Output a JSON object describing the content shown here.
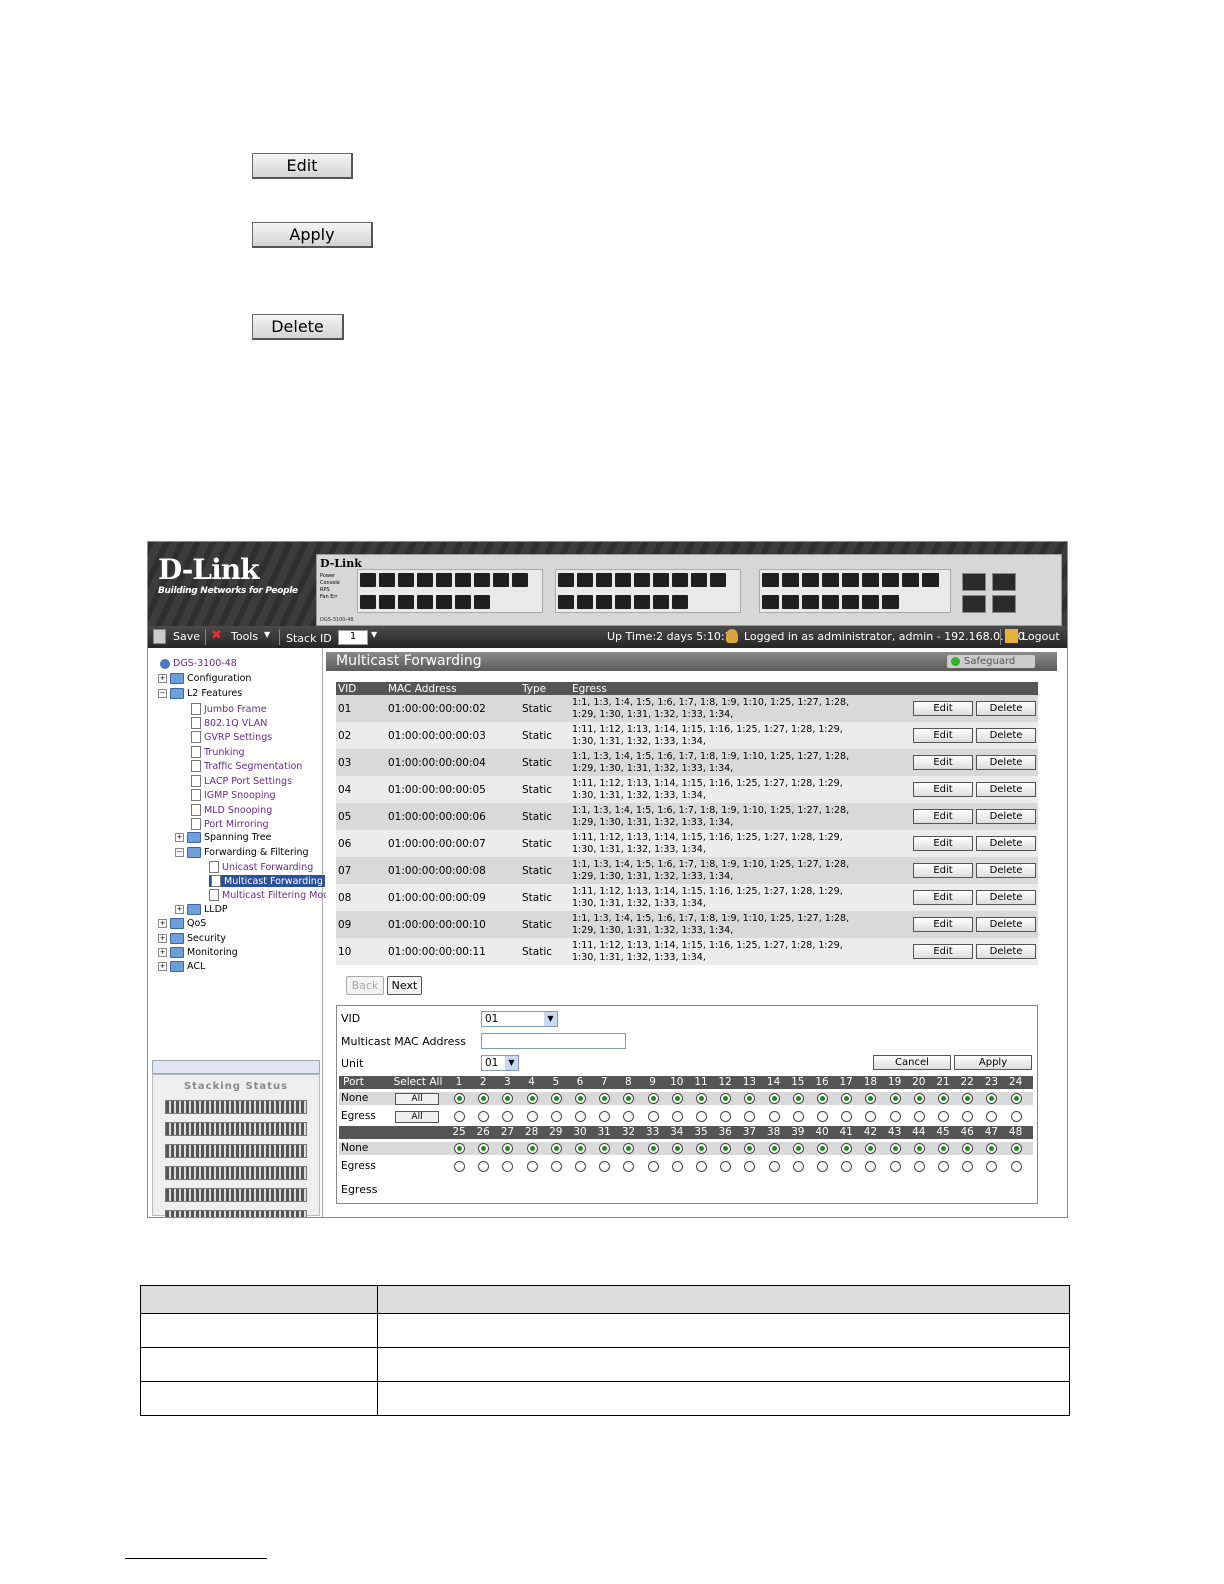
{
  "doc_buttons": {
    "edit": "Edit",
    "apply": "Apply",
    "delete": "Delete"
  },
  "banner": {
    "brand": "D-Link",
    "tagline": "Building Networks for People",
    "switch_brand": "D-Link",
    "switch_model": "DGS-3100-48",
    "leds": [
      "Power",
      "Console",
      "RPS",
      "Fan Err"
    ]
  },
  "toolbar": {
    "save": "Save",
    "tools": "Tools",
    "stack_id_label": "Stack ID",
    "stack_id_value": "1",
    "uptime": "Up Time:2 days 5:10:13",
    "logged_in": "Logged in as administrator, admin - 192.168.0.100",
    "logout": "Logout"
  },
  "sidebar": {
    "root": "DGS-3100-48",
    "configuration": "Configuration",
    "l2": "L2 Features",
    "items": [
      "Jumbo Frame",
      "802.1Q VLAN",
      "GVRP Settings",
      "Trunking",
      "Traffic Segmentation",
      "LACP Port Settings",
      "IGMP Snooping",
      "MLD Snooping",
      "Port Mirroring"
    ],
    "spanning": "Spanning Tree",
    "fwd": "Forwarding & Filtering",
    "fwd_items": [
      "Unicast Forwarding",
      "Multicast Forwarding",
      "Multicast Filtering Mode"
    ],
    "lldp": "LLDP",
    "qos": "QoS",
    "security": "Security",
    "monitoring": "Monitoring",
    "acl": "ACL",
    "stacking": "Stacking Status"
  },
  "page": {
    "title": "Multicast Forwarding",
    "safeguard": "Safeguard"
  },
  "table": {
    "headers": [
      "VID",
      "MAC Address",
      "Type",
      "Egress"
    ],
    "edit": "Edit",
    "delete": "Delete",
    "rows": [
      {
        "vid": "01",
        "mac": "01:00:00:00:00:02",
        "type": "Static",
        "egress1": "1:1, 1:3, 1:4, 1:5, 1:6, 1:7, 1:8, 1:9, 1:10, 1:25, 1:27, 1:28,",
        "egress2": "1:29, 1:30, 1:31, 1:32, 1:33, 1:34,"
      },
      {
        "vid": "02",
        "mac": "01:00:00:00:00:03",
        "type": "Static",
        "egress1": "1:11, 1:12, 1:13, 1:14, 1:15, 1:16, 1:25, 1:27, 1:28, 1:29,",
        "egress2": "1:30, 1:31, 1:32, 1:33, 1:34,"
      },
      {
        "vid": "03",
        "mac": "01:00:00:00:00:04",
        "type": "Static",
        "egress1": "1:1, 1:3, 1:4, 1:5, 1:6, 1:7, 1:8, 1:9, 1:10, 1:25, 1:27, 1:28,",
        "egress2": "1:29, 1:30, 1:31, 1:32, 1:33, 1:34,"
      },
      {
        "vid": "04",
        "mac": "01:00:00:00:00:05",
        "type": "Static",
        "egress1": "1:11, 1:12, 1:13, 1:14, 1:15, 1:16, 1:25, 1:27, 1:28, 1:29,",
        "egress2": "1:30, 1:31, 1:32, 1:33, 1:34,"
      },
      {
        "vid": "05",
        "mac": "01:00:00:00:00:06",
        "type": "Static",
        "egress1": "1:1, 1:3, 1:4, 1:5, 1:6, 1:7, 1:8, 1:9, 1:10, 1:25, 1:27, 1:28,",
        "egress2": "1:29, 1:30, 1:31, 1:32, 1:33, 1:34,"
      },
      {
        "vid": "06",
        "mac": "01:00:00:00:00:07",
        "type": "Static",
        "egress1": "1:11, 1:12, 1:13, 1:14, 1:15, 1:16, 1:25, 1:27, 1:28, 1:29,",
        "egress2": "1:30, 1:31, 1:32, 1:33, 1:34,"
      },
      {
        "vid": "07",
        "mac": "01:00:00:00:00:08",
        "type": "Static",
        "egress1": "1:1, 1:3, 1:4, 1:5, 1:6, 1:7, 1:8, 1:9, 1:10, 1:25, 1:27, 1:28,",
        "egress2": "1:29, 1:30, 1:31, 1:32, 1:33, 1:34,"
      },
      {
        "vid": "08",
        "mac": "01:00:00:00:00:09",
        "type": "Static",
        "egress1": "1:11, 1:12, 1:13, 1:14, 1:15, 1:16, 1:25, 1:27, 1:28, 1:29,",
        "egress2": "1:30, 1:31, 1:32, 1:33, 1:34,"
      },
      {
        "vid": "09",
        "mac": "01:00:00:00:00:10",
        "type": "Static",
        "egress1": "1:1, 1:3, 1:4, 1:5, 1:6, 1:7, 1:8, 1:9, 1:10, 1:25, 1:27, 1:28,",
        "egress2": "1:29, 1:30, 1:31, 1:32, 1:33, 1:34,"
      },
      {
        "vid": "10",
        "mac": "01:00:00:00:00:11",
        "type": "Static",
        "egress1": "1:11, 1:12, 1:13, 1:14, 1:15, 1:16, 1:25, 1:27, 1:28, 1:29,",
        "egress2": "1:30, 1:31, 1:32, 1:33, 1:34,"
      }
    ],
    "back": "Back",
    "next": "Next"
  },
  "form": {
    "vid_label": "VID",
    "vid_value": "01",
    "mac_label": "Multicast MAC Address",
    "mac_value": "",
    "unit_label": "Unit",
    "unit_value": "01",
    "cancel": "Cancel",
    "apply": "Apply",
    "port_label": "Port",
    "select_all": "Select All",
    "none_label": "None",
    "egress_label": "Egress",
    "all_button": "All",
    "egress_footer": "Egress",
    "ports_row1": [
      "1",
      "2",
      "3",
      "4",
      "5",
      "6",
      "7",
      "8",
      "9",
      "10",
      "11",
      "12",
      "13",
      "14",
      "15",
      "16",
      "17",
      "18",
      "19",
      "20",
      "21",
      "22",
      "23",
      "24"
    ],
    "ports_row2": [
      "25",
      "26",
      "27",
      "28",
      "29",
      "30",
      "31",
      "32",
      "33",
      "34",
      "35",
      "36",
      "37",
      "38",
      "39",
      "40",
      "41",
      "42",
      "43",
      "44",
      "45",
      "46",
      "47",
      "48"
    ]
  }
}
